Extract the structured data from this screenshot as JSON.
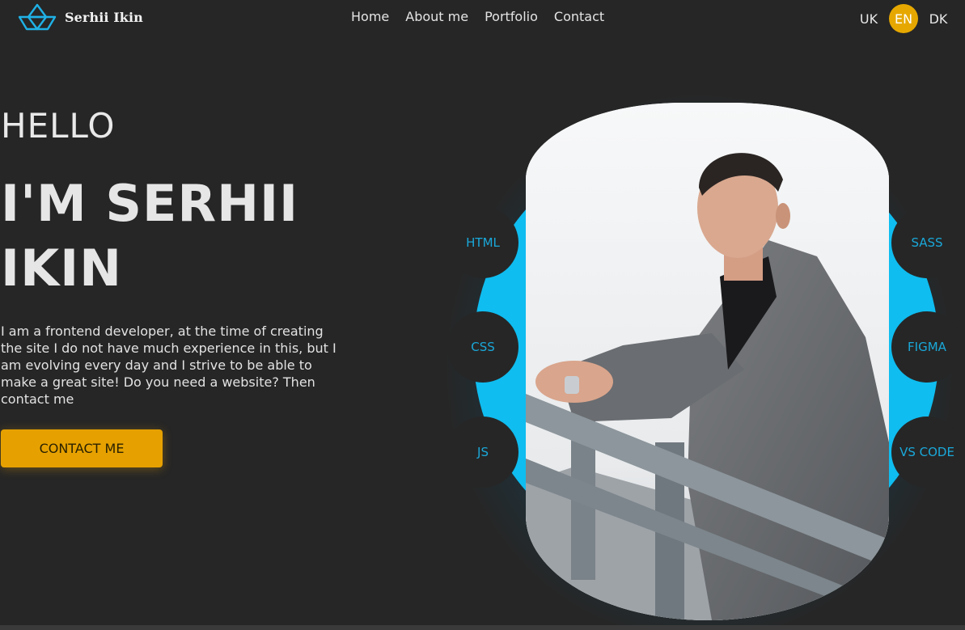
{
  "header": {
    "brand": "Serhii Ikin",
    "nav": [
      "Home",
      "About me",
      "Portfolio",
      "Contact"
    ],
    "languages": [
      "UK",
      "EN",
      "DK"
    ],
    "active_language": "EN"
  },
  "hero": {
    "greeting": "HELLO",
    "name": "I'M SERHII IKIN",
    "description": "I am a frontend developer, at the time of creating the site I do not have much experience in this, but I am evolving every day and I strive to be able to make a great site! Do you need a website? Then contact me",
    "cta_label": "CONTACT ME"
  },
  "skills": {
    "left": [
      "HTML",
      "CSS",
      "JS"
    ],
    "right": [
      "SASS",
      "FIGMA",
      "VS CODE"
    ]
  },
  "colors": {
    "background": "#262626",
    "accent": "#e6a800",
    "cyan": "#0fbdf0",
    "skill_text": "#1aa8d9"
  }
}
